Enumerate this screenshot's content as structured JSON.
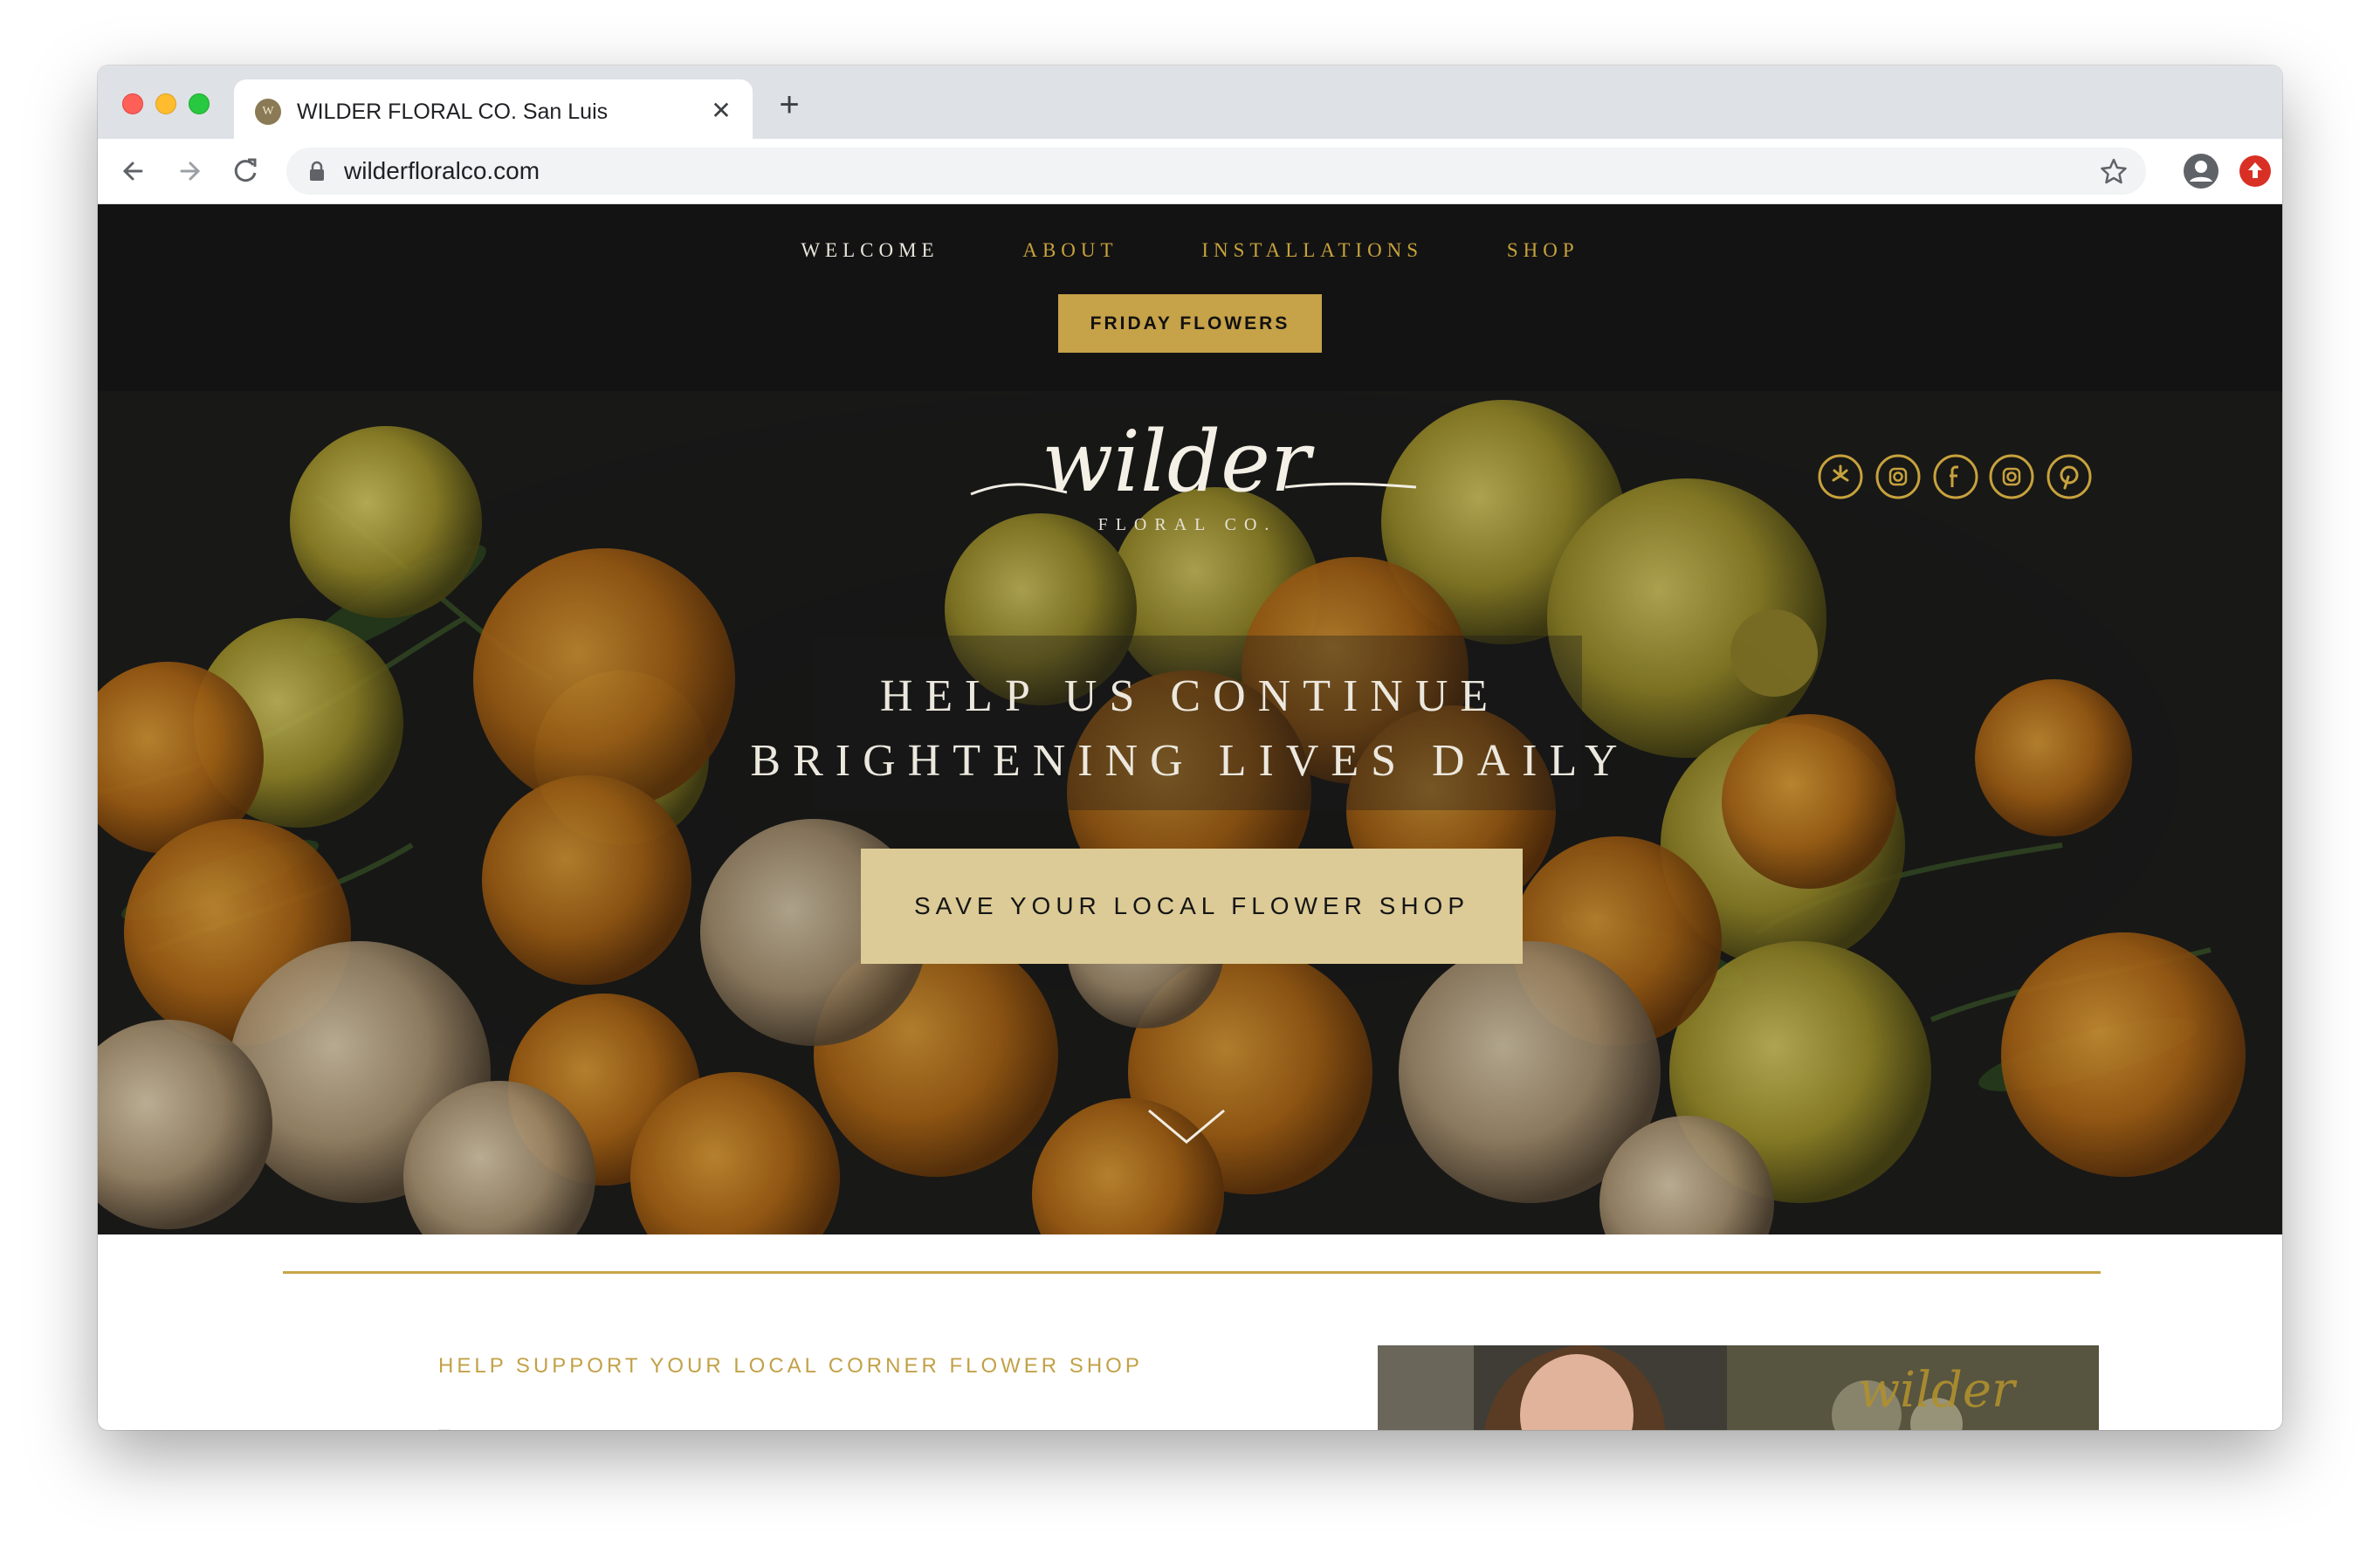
{
  "browser": {
    "tab_title": "WILDER FLORAL CO. San Luis",
    "tab_favicon_text": "W",
    "url": "wilderfloralco.com",
    "icons": [
      "back-icon",
      "forward-icon",
      "reload-icon",
      "lock-icon",
      "star-icon",
      "profile-icon",
      "extension-icon",
      "close-icon",
      "new-tab-icon"
    ]
  },
  "site": {
    "nav": {
      "items": [
        "WELCOME",
        "ABOUT",
        "INSTALLATIONS",
        "SHOP"
      ],
      "cta": "FRIDAY FLOWERS"
    },
    "logo": {
      "script": "wilder",
      "sub": "FLORAL CO."
    },
    "social_icons": [
      "yelp-icon",
      "instagram-icon",
      "facebook-icon",
      "instagram-icon",
      "pinterest-icon"
    ],
    "hero": {
      "line1": "HELP US CONTINUE",
      "line2": "BRIGHTENING LIVES DAILY",
      "button": "SAVE YOUR LOCAL FLOWER SHOP"
    },
    "content": {
      "heading": "HELP SUPPORT YOUR LOCAL CORNER FLOWER SHOP",
      "dash": "–"
    },
    "colors": {
      "gold": "#c7a23c",
      "header_bg": "#131313",
      "cta_bg": "#dccb96"
    }
  }
}
